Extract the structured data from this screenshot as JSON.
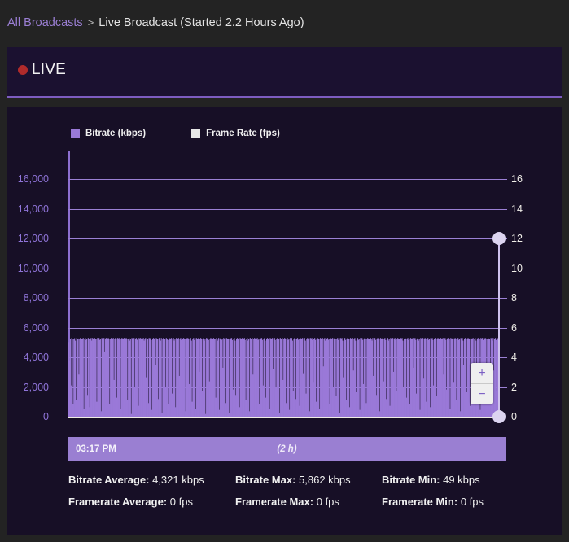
{
  "breadcrumb": {
    "link_label": "All Broadcasts",
    "separator": ">",
    "current_label": "Live Broadcast (Started 2.2 Hours Ago)"
  },
  "live_card": {
    "status_label": "LIVE",
    "dot_icon": "live-dot-icon",
    "dot_color": "#b02b2b",
    "accent_color": "#7d5cc0"
  },
  "legend": [
    {
      "label": "Bitrate (kbps)",
      "color": "#9a79d8",
      "swatch_icon": "legend-swatch-icon"
    },
    {
      "label": "Frame Rate (fps)",
      "color": "#e6e6e6",
      "swatch_icon": "legend-swatch-icon"
    }
  ],
  "controls": {
    "zoom_in_label": "+",
    "zoom_out_label": "−",
    "zoom_in_icon": "plus-icon",
    "zoom_out_icon": "minus-icon",
    "range_handle_top_icon": "range-handle-icon",
    "range_handle_bottom_icon": "range-handle-icon"
  },
  "timeline": {
    "start_time": "03:17 PM",
    "duration": "(2 h)"
  },
  "stats": {
    "rows": [
      [
        {
          "label": "Bitrate Average:",
          "value": " 4,321 kbps"
        },
        {
          "label": "Bitrate Max:",
          "value": " 5,862 kbps"
        },
        {
          "label": "Bitrate Min:",
          "value": " 49 kbps"
        }
      ],
      [
        {
          "label": "Framerate Average:",
          "value": " 0 fps"
        },
        {
          "label": "Framerate Max:",
          "value": " 0 fps"
        },
        {
          "label": "Framerate Min:",
          "value": " 0 fps"
        }
      ]
    ]
  },
  "chart_data": {
    "type": "bar",
    "title": "",
    "xlabel": "",
    "ylabel": "Bitrate (kbps)",
    "ylabel_right": "Frame Rate (fps)",
    "grid": true,
    "legend_position": "top-left",
    "yticks_left": [
      "0",
      "2,000",
      "4,000",
      "6,000",
      "8,000",
      "10,000",
      "12,000",
      "14,000",
      "16,000"
    ],
    "yticks_right": [
      "0",
      "2",
      "4",
      "6",
      "8",
      "10",
      "12",
      "14",
      "16"
    ],
    "ylim": [
      0,
      17500
    ],
    "ylim_right": [
      0,
      17.5
    ],
    "x_start_label": "03:17 PM",
    "x_span": "(2 h)",
    "series": [
      {
        "name": "Bitrate (kbps)",
        "color": "#9a79d8",
        "average": 4321,
        "max": 5862,
        "min": 49,
        "values": [
          5500,
          4100,
          5700,
          2300,
          5800,
          5750,
          900,
          5700,
          5780,
          5600,
          1200,
          5800,
          5700,
          5760,
          3100,
          5700,
          5800,
          2000,
          5700,
          5750,
          5800,
          600,
          5700,
          5800,
          5650,
          5720,
          1600,
          5800,
          5700,
          700,
          5750,
          5800,
          5600,
          5800,
          5700,
          2500,
          5800,
          5750,
          5700,
          1100,
          5800,
          5700,
          5800,
          5640,
          5700,
          400,
          5800,
          5700,
          5760,
          5800,
          4800,
          5700,
          5800,
          1800,
          5700,
          5800,
          5750,
          900,
          5700,
          5800,
          5600,
          5700,
          5800,
          2700,
          5750,
          5800,
          5700,
          1400,
          5800,
          5700,
          5800,
          5650,
          600,
          5700,
          5800,
          5760,
          5700,
          5800,
          3400,
          5700,
          5800,
          5750,
          1200,
          5700,
          5800,
          5600,
          5700,
          200,
          5800,
          5700,
          5750,
          5800,
          2100,
          5700,
          5800,
          5650,
          5700,
          800,
          5800,
          5700,
          5800,
          5750,
          1600,
          5700,
          5800,
          5600,
          5700,
          5800,
          2900,
          5750,
          5700,
          1000,
          5800,
          5700,
          5800,
          5640,
          500,
          5700,
          5800,
          5760,
          5700,
          3800,
          5800,
          5700,
          5750,
          1300,
          5800,
          5700,
          5600,
          5800,
          300,
          5700,
          5800,
          5750,
          5700,
          2200,
          5800,
          5700,
          5650,
          900,
          5800,
          5700,
          5760,
          5800,
          1700,
          5700,
          5800,
          5600,
          5700,
          700,
          5800,
          5750,
          5700,
          5800,
          3000,
          5700,
          5800,
          5650,
          1500,
          5700,
          5800,
          5760,
          5700,
          400,
          5800,
          5700,
          5800,
          5750,
          2400,
          5700,
          5800,
          5600,
          1100,
          5700,
          5800,
          5640,
          5700,
          600,
          5800,
          5700,
          5760,
          5800,
          3300,
          5700,
          5800,
          5750,
          1900,
          5700,
          5800,
          5600,
          5700,
          200,
          5800,
          5700,
          5800,
          5650,
          2600,
          5700,
          5800,
          5760,
          800,
          5700,
          5800,
          5750,
          5700,
          1400,
          5800,
          5700,
          5600,
          5800,
          500,
          5700,
          5800,
          5650,
          5700,
          3600,
          5800,
          5700,
          5750,
          1000,
          5800,
          5700,
          5760,
          5700,
          300,
          5800,
          5700,
          5800,
          5640,
          2000,
          5700,
          5800,
          5600,
          1600,
          5700,
          5800,
          5750,
          5700,
          700,
          5800,
          5700,
          5760,
          5800,
          2800,
          5700,
          5800,
          5650,
          1200,
          5700,
          5800,
          5600,
          5700,
          400,
          5800,
          5700,
          5750,
          5800,
          3100,
          5700,
          5800,
          5760,
          1800,
          5700,
          5800,
          5640,
          5700,
          900,
          5800,
          5700,
          5800,
          5650,
          2300,
          5700,
          5800,
          5600,
          1400,
          5700,
          5800,
          5750,
          5700,
          600,
          5800,
          5700,
          5760,
          5800,
          3500,
          5700,
          5800,
          5650,
          2100,
          5700,
          5800,
          5600,
          5700,
          300,
          5800,
          5700,
          5750,
          5800,
          2700,
          5700,
          5800,
          5760,
          1000,
          5700,
          5800,
          5640,
          5700,
          500,
          5800,
          5700,
          5800,
          5600,
          1900,
          5700,
          5800,
          5750,
          1300,
          5700,
          5800,
          5650,
          5700,
          800,
          5800,
          5700,
          5760,
          5800,
          3200,
          5700,
          5800,
          5600,
          1700,
          5700,
          5800,
          5750,
          5700,
          400,
          5800,
          5700,
          5800,
          5640,
          2500,
          5700,
          5800,
          5650,
          1100,
          5700,
          5800,
          5760,
          5700,
          600,
          5800,
          5700,
          5750,
          5800,
          3700,
          5700,
          5800,
          5600,
          2000,
          5700,
          5800,
          5650,
          5700,
          900,
          5800,
          5700,
          5760,
          5800,
          2200,
          5700,
          5800,
          5750,
          1500,
          5700,
          5800,
          5640,
          5700,
          300,
          5800,
          5700,
          5800,
          5600,
          2900,
          5700,
          5800,
          5650,
          1200,
          5700,
          5800,
          5760,
          5700,
          700,
          5800,
          5700,
          5750,
          5800,
          3400,
          5700,
          5800,
          5600,
          1800,
          5700,
          5800,
          5640,
          5700,
          500,
          5800,
          5700,
          5800,
          5650,
          2400,
          5700,
          5800,
          5760,
          1000,
          5700,
          5800,
          5750,
          5700,
          600,
          5800,
          5700,
          5600,
          5800,
          3000,
          5700,
          5800,
          5650,
          1600,
          5700,
          5800,
          5760,
          5700,
          400,
          5800,
          5700,
          5750,
          5800,
          2600,
          5700,
          5800,
          5640,
          1300,
          5700,
          5800,
          5600,
          5700,
          800,
          5800,
          5700,
          5760,
          5800,
          3300,
          5700,
          5800,
          5650,
          1900,
          5700,
          5800,
          5750,
          5700,
          200,
          5800,
          5700,
          5800,
          5600,
          2100,
          5700,
          5800,
          5760,
          1400,
          5700,
          5800,
          5640,
          5700,
          900,
          5800,
          5700,
          5750,
          5800,
          3600,
          5700,
          5800,
          5650,
          1700,
          5700,
          5800,
          5600,
          5700,
          500,
          5800,
          5700,
          5760,
          5800,
          2800,
          5700,
          5800,
          5750,
          1100,
          5700,
          5800,
          5640,
          5700,
          700,
          5800,
          5700,
          5800,
          5650,
          2300,
          5700,
          5800,
          5600,
          1500,
          5700,
          5800,
          5760,
          5700,
          300,
          5800,
          5700,
          5750,
          5800,
          3100,
          5700,
          5800,
          5650,
          2000,
          5700,
          5800,
          5600,
          5700,
          600,
          5800,
          5700,
          5760,
          5800,
          2500,
          5700,
          5800,
          5750,
          1200,
          5700,
          5800,
          5640,
          5700,
          400,
          5800,
          5700,
          5800,
          5600,
          3800,
          5700,
          5800,
          5650,
          1800,
          5700,
          5800,
          5760,
          5700,
          800,
          5800,
          5700,
          5750,
          5800,
          2700,
          5700,
          5800,
          5600,
          1600,
          5700,
          5800,
          5640,
          5700,
          500,
          5800,
          5700,
          5800,
          5650,
          2200,
          5700,
          5800,
          5760,
          1300,
          5700,
          5800,
          5750,
          5700,
          900,
          5800,
          5700,
          5600,
          5800,
          3400,
          5700,
          5800,
          5650,
          1900,
          5700,
          5800,
          5760,
          5700
        ]
      },
      {
        "name": "Frame Rate (fps)",
        "color": "#e6e6e6",
        "average": 0,
        "max": 0,
        "min": 0,
        "values": []
      }
    ]
  }
}
